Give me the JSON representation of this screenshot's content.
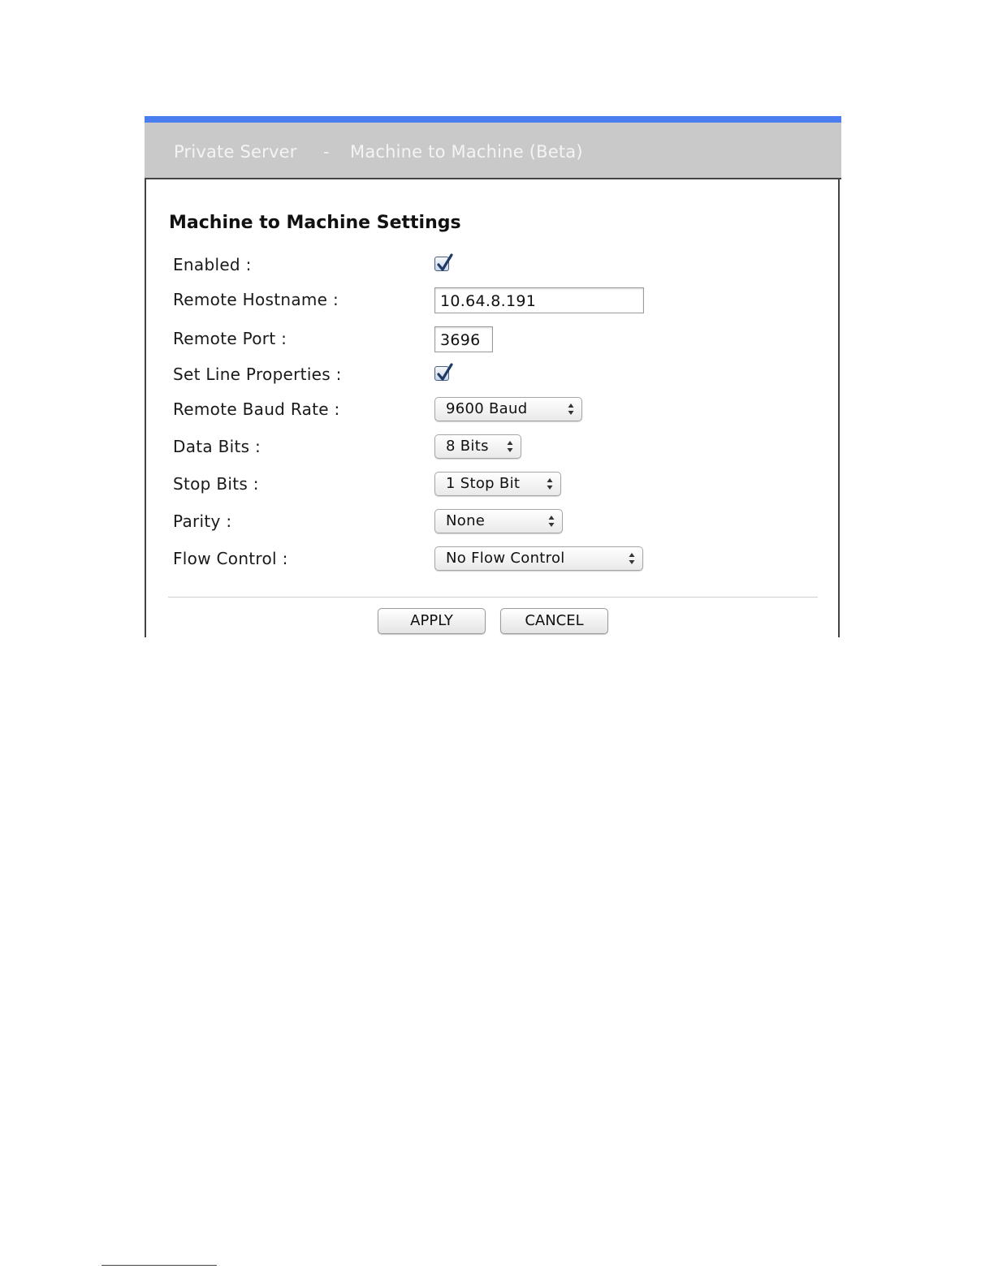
{
  "header": {
    "left": "Private Server",
    "separator": "-",
    "right": "Machine to Machine (Beta)",
    "accent_color": "#4a7ef0"
  },
  "section_title": "Machine to Machine Settings",
  "fields": {
    "enabled": {
      "label": "Enabled :",
      "checked": true
    },
    "remote_hostname": {
      "label": "Remote Hostname :",
      "value": "10.64.8.191"
    },
    "remote_port": {
      "label": "Remote Port :",
      "value": "3696"
    },
    "set_line_properties": {
      "label": "Set Line Properties :",
      "checked": true
    },
    "remote_baud_rate": {
      "label": "Remote Baud Rate :",
      "selected": "9600 Baud"
    },
    "data_bits": {
      "label": "Data Bits :",
      "selected": "8 Bits"
    },
    "stop_bits": {
      "label": "Stop Bits :",
      "selected": "1 Stop Bit"
    },
    "parity": {
      "label": "Parity :",
      "selected": "None"
    },
    "flow_control": {
      "label": "Flow Control :",
      "selected": "No Flow Control"
    }
  },
  "buttons": {
    "apply": "APPLY",
    "cancel": "CANCEL"
  },
  "icons": {
    "checkbox_checked": "checkmark-icon",
    "select_arrows": "up-down-arrows-icon"
  }
}
